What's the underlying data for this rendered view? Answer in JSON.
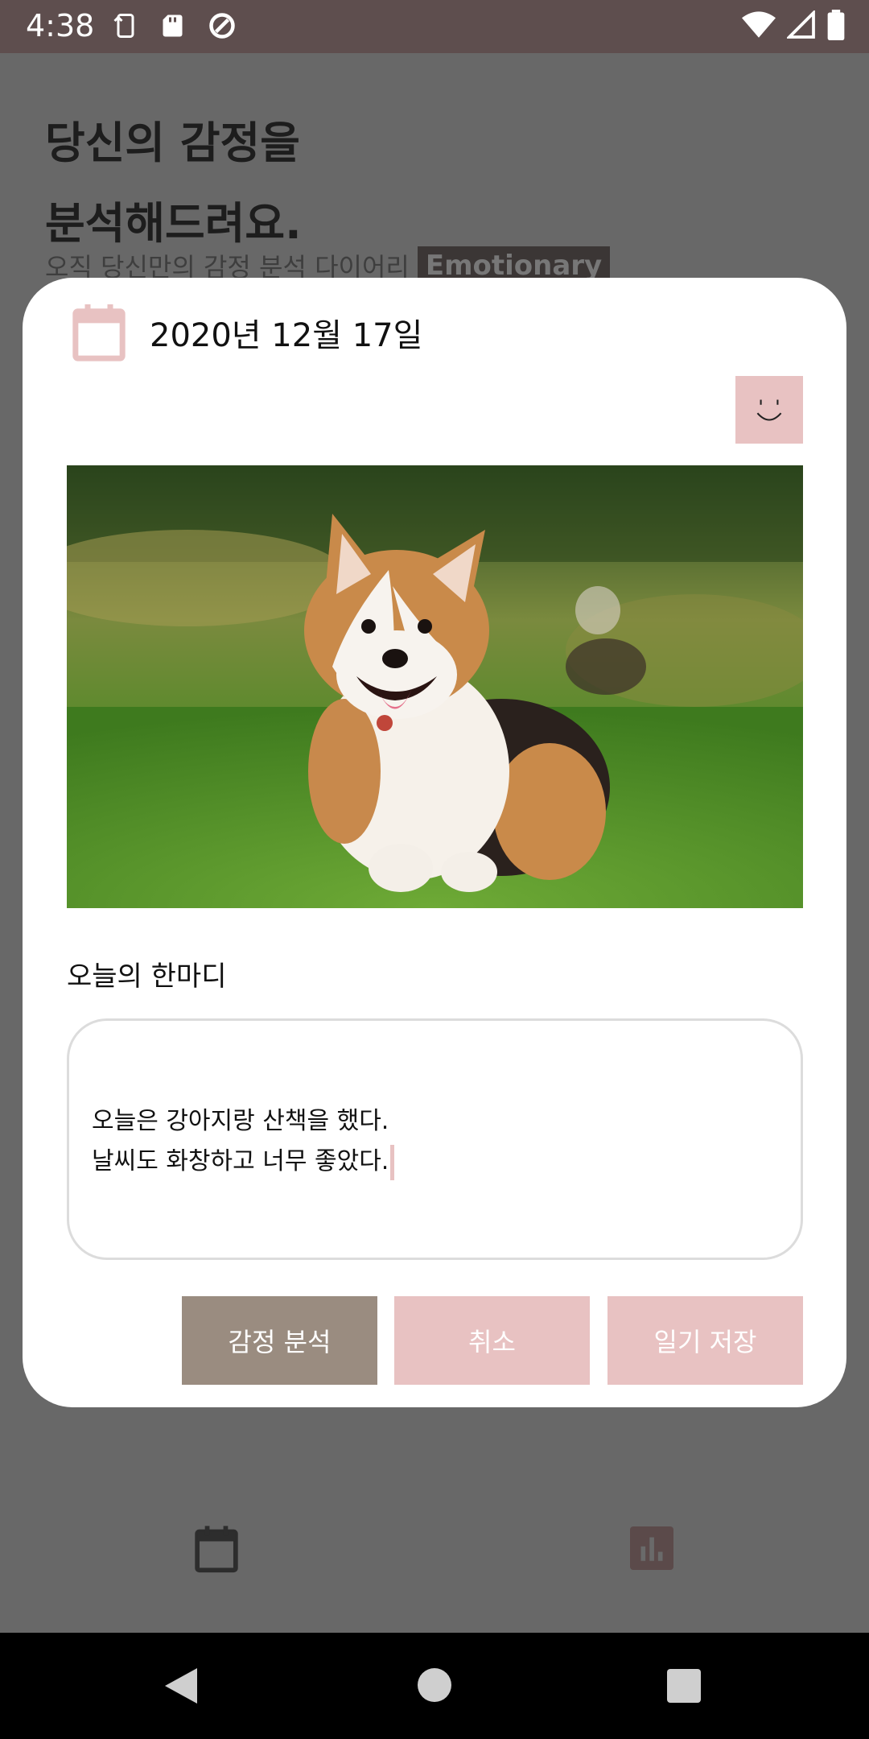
{
  "status_bar": {
    "time": "4:38",
    "left_icons": [
      "rotate-icon",
      "sd-card-icon",
      "data-saver-icon"
    ],
    "right_icons": [
      "wifi-icon",
      "signal-icon",
      "battery-icon"
    ]
  },
  "background": {
    "headline_line1": "당신의 감정을",
    "headline_line2": "분석해드려요.",
    "subtitle": "오직 당신만의 감정 분석 다이어리",
    "brand": "Emotionary",
    "nav_icons": [
      "calendar-icon",
      "bar-chart-icon"
    ]
  },
  "dialog": {
    "date": "2020년 12월 17일",
    "emotion_icon": "smiley-face-icon",
    "photo": "corgi-photo",
    "section_label": "오늘의 한마디",
    "diary_line1": "오늘은 강아지랑 산책을 했다.",
    "diary_line2": "날씨도 화창하고 너무 좋았다.",
    "buttons": {
      "analyze": "감정 분석",
      "cancel": "취소",
      "save": "일기 저장"
    }
  },
  "colors": {
    "accent_pink": "#e8c2c2",
    "analyze_brown": "#9a8c80",
    "status_bar": "#5e4e4e"
  }
}
